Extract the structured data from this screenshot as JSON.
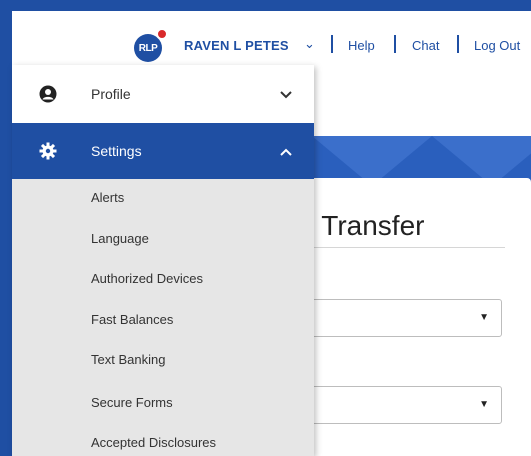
{
  "header": {
    "avatar_initials": "RLP",
    "user_name": "RAVEN L PETES",
    "links": {
      "help": "Help",
      "chat": "Chat",
      "logout": "Log Out"
    }
  },
  "menu": {
    "profile": {
      "label": "Profile",
      "icon": "user-circle-icon",
      "expanded": false
    },
    "settings": {
      "label": "Settings",
      "icon": "gear-icon",
      "expanded": true
    },
    "settings_items": [
      "Alerts",
      "Language",
      "Authorized Devices",
      "Fast Balances",
      "Text Banking",
      "Secure Forms",
      "Accepted Disclosures"
    ]
  },
  "page": {
    "title_visible": "k Transfer"
  },
  "colors": {
    "brand_blue": "#1f4fa3",
    "badge_red": "#d9292b",
    "menu_bg": "#e6e6e6"
  }
}
